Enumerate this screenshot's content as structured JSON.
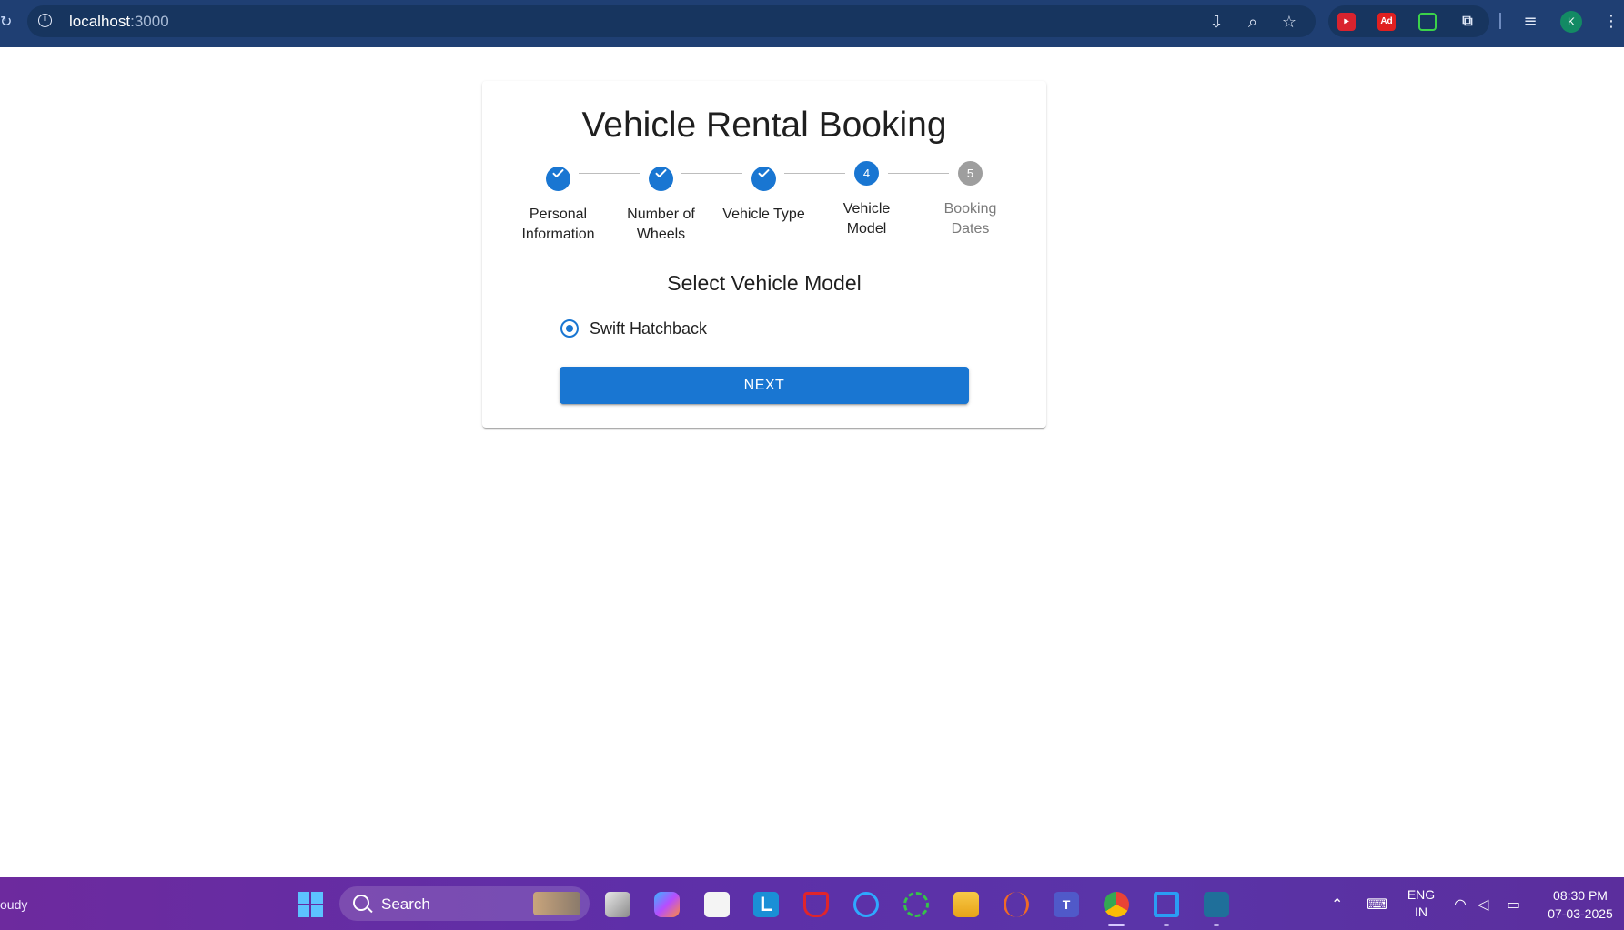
{
  "browser": {
    "url_host": "localhost",
    "url_port": ":3000",
    "profile_initial": "K"
  },
  "app": {
    "title": "Vehicle Rental Booking",
    "steps": [
      {
        "label_line1": "Personal",
        "label_line2": "Information",
        "state": "completed"
      },
      {
        "label_line1": "Number of",
        "label_line2": "Wheels",
        "state": "completed"
      },
      {
        "label_line1": "Vehicle Type",
        "label_line2": "",
        "state": "completed"
      },
      {
        "label_line1": "Vehicle",
        "label_line2": "Model",
        "state": "active",
        "number": "4"
      },
      {
        "label_line1": "Booking",
        "label_line2": "Dates",
        "state": "inactive",
        "number": "5"
      }
    ],
    "section_title": "Select Vehicle Model",
    "options": [
      {
        "label": "Swift Hatchback",
        "selected": true
      }
    ],
    "next_label": "NEXT",
    "accent_color": "#1976d2"
  },
  "taskbar": {
    "weather_text": "oudy",
    "search_placeholder": "Search",
    "language_line1": "ENG",
    "language_line2": "IN",
    "time": "08:30 PM",
    "date": "07-03-2025"
  }
}
